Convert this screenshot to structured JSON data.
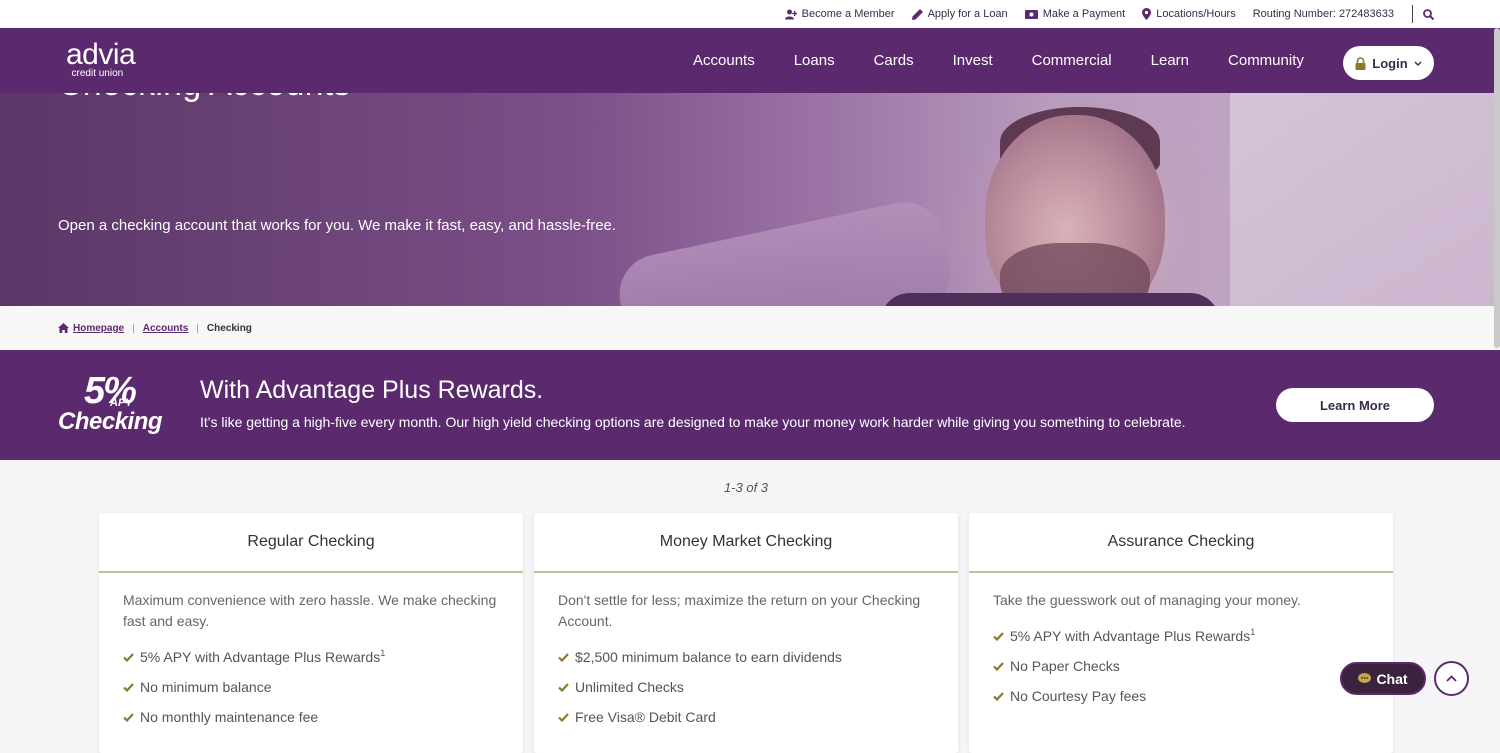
{
  "utility": {
    "become_member": "Become a Member",
    "apply_loan": "Apply for a Loan",
    "make_payment": "Make a Payment",
    "locations": "Locations/Hours",
    "routing": "Routing Number: 272483633"
  },
  "brand": {
    "name": "advia",
    "sub": "credit union"
  },
  "nav": {
    "items": [
      "Accounts",
      "Loans",
      "Cards",
      "Invest",
      "Commercial",
      "Learn",
      "Community"
    ],
    "login": "Login"
  },
  "hero": {
    "title": "Checking Accounts",
    "subtitle": "Open a checking account that works for you. We make it fast, easy, and hassle-free."
  },
  "breadcrumb": {
    "home": "Homepage",
    "accounts": "Accounts",
    "current": "Checking"
  },
  "promo": {
    "badge_pct": "5%",
    "badge_apy": "APY",
    "badge_word": "Checking",
    "title": "With Advantage Plus Rewards.",
    "text": "It's like getting a high-five every month. Our high yield checking options are designed to make your money work harder while giving you something to celebrate.",
    "button": "Learn More"
  },
  "results": {
    "count": "1-3 of 3"
  },
  "cards": [
    {
      "title": "Regular Checking",
      "desc": "Maximum convenience with zero hassle. We make checking fast and easy.",
      "features": [
        "5% APY with Advantage Plus Rewards",
        "No minimum balance",
        "No monthly maintenance fee"
      ],
      "sup": "1"
    },
    {
      "title": "Money Market Checking",
      "desc": "Don't settle for less; maximize the return on your Checking Account.",
      "features": [
        "$2,500 minimum balance to earn dividends",
        "Unlimited Checks",
        "Free Visa® Debit Card"
      ]
    },
    {
      "title": "Assurance Checking",
      "desc": "Take the guesswork out of managing your money.",
      "features": [
        "5% APY with Advantage Plus Rewards",
        "No Paper Checks",
        "No Courtesy Pay fees"
      ],
      "sup": "1"
    }
  ],
  "widgets": {
    "chat": "Chat"
  },
  "colors": {
    "brand_purple": "#5b2a6e",
    "accent_gold": "#8a7a2e",
    "card_rule": "#c5bf9c"
  }
}
